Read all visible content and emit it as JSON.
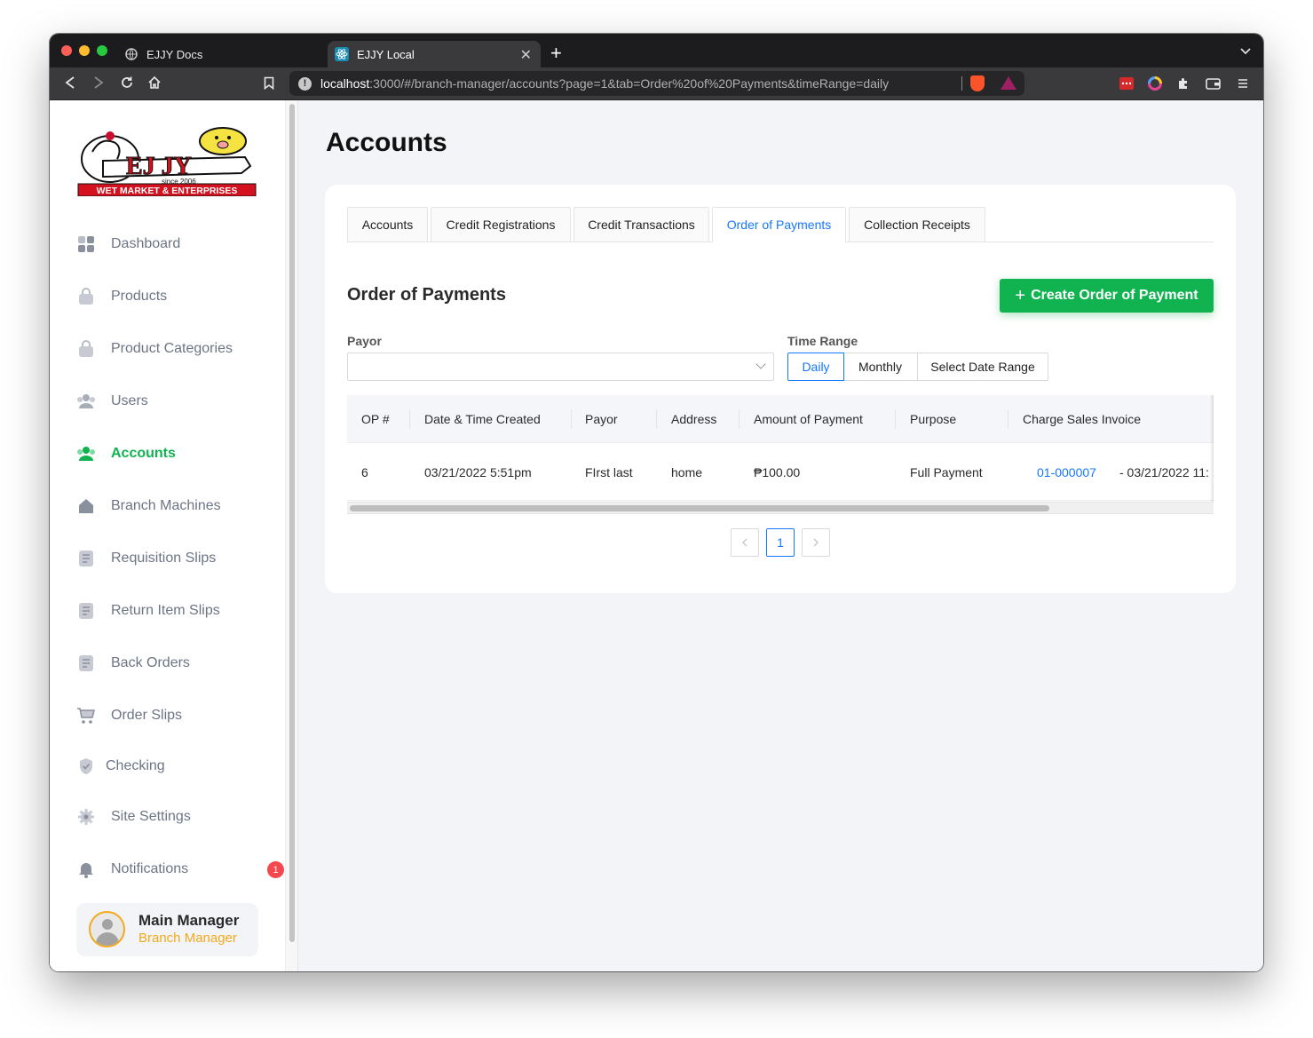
{
  "browser": {
    "tabs": [
      {
        "title": "EJJY Docs",
        "active": false
      },
      {
        "title": "EJJY Local",
        "active": true
      }
    ],
    "url_host": "localhost",
    "url_rest": ":3000/#/branch-manager/accounts?page=1&tab=Order%20of%20Payments&timeRange=daily"
  },
  "sidebar": {
    "logo": {
      "main": "EJ JY",
      "since": "since 2006",
      "tagline": "WET MARKET & ENTERPRISES"
    },
    "items": [
      {
        "label": "Dashboard",
        "icon": "dashboard-icon",
        "active": false
      },
      {
        "label": "Products",
        "icon": "bag-icon",
        "active": false
      },
      {
        "label": "Product Categories",
        "icon": "bag-icon",
        "active": false
      },
      {
        "label": "Users",
        "icon": "users-icon",
        "active": false
      },
      {
        "label": "Accounts",
        "icon": "users-icon",
        "active": true
      },
      {
        "label": "Branch Machines",
        "icon": "home-icon",
        "active": false
      },
      {
        "label": "Requisition Slips",
        "icon": "document-icon",
        "active": false
      },
      {
        "label": "Return Item Slips",
        "icon": "document-icon",
        "active": false
      },
      {
        "label": "Back Orders",
        "icon": "document-icon",
        "active": false
      },
      {
        "label": "Order Slips",
        "icon": "cart-icon",
        "active": false
      },
      {
        "label": "Checking",
        "icon": "shield-icon",
        "active": false
      },
      {
        "label": "Site Settings",
        "icon": "gear-icon",
        "active": false
      },
      {
        "label": "Notifications",
        "icon": "bell-icon",
        "active": false,
        "badge": "1"
      }
    ],
    "user": {
      "name": "Main Manager",
      "role": "Branch Manager"
    }
  },
  "main": {
    "title": "Accounts",
    "tabs": [
      "Accounts",
      "Credit Registrations",
      "Credit Transactions",
      "Order of Payments",
      "Collection Receipts"
    ],
    "active_tab": "Order of Payments",
    "section_title": "Order of Payments",
    "create_button": "Create Order of Payment",
    "payor_label": "Payor",
    "payor_value": "",
    "time_range_label": "Time Range",
    "time_range_options": [
      "Daily",
      "Monthly",
      "Select Date Range"
    ],
    "time_range_selected": "Daily",
    "table": {
      "columns": [
        "OP #",
        "Date & Time Created",
        "Payor",
        "Address",
        "Amount of Payment",
        "Purpose",
        "Charge Sales Invoice"
      ],
      "rows": [
        {
          "op": "6",
          "date": "03/21/2022 5:51pm",
          "payor": "FIrst last",
          "address": "home",
          "amount": "₱100.00",
          "purpose": "Full Payment",
          "invoice": "01-000007",
          "invoice_suffix": "- 03/21/2022 11:"
        }
      ]
    },
    "pagination": {
      "prev": "<",
      "current": "1",
      "next": ">"
    }
  },
  "colors": {
    "accent_green": "#10b350",
    "link_blue": "#1677ff",
    "badge_red": "#f5484e",
    "role_orange": "#f3a91a"
  }
}
